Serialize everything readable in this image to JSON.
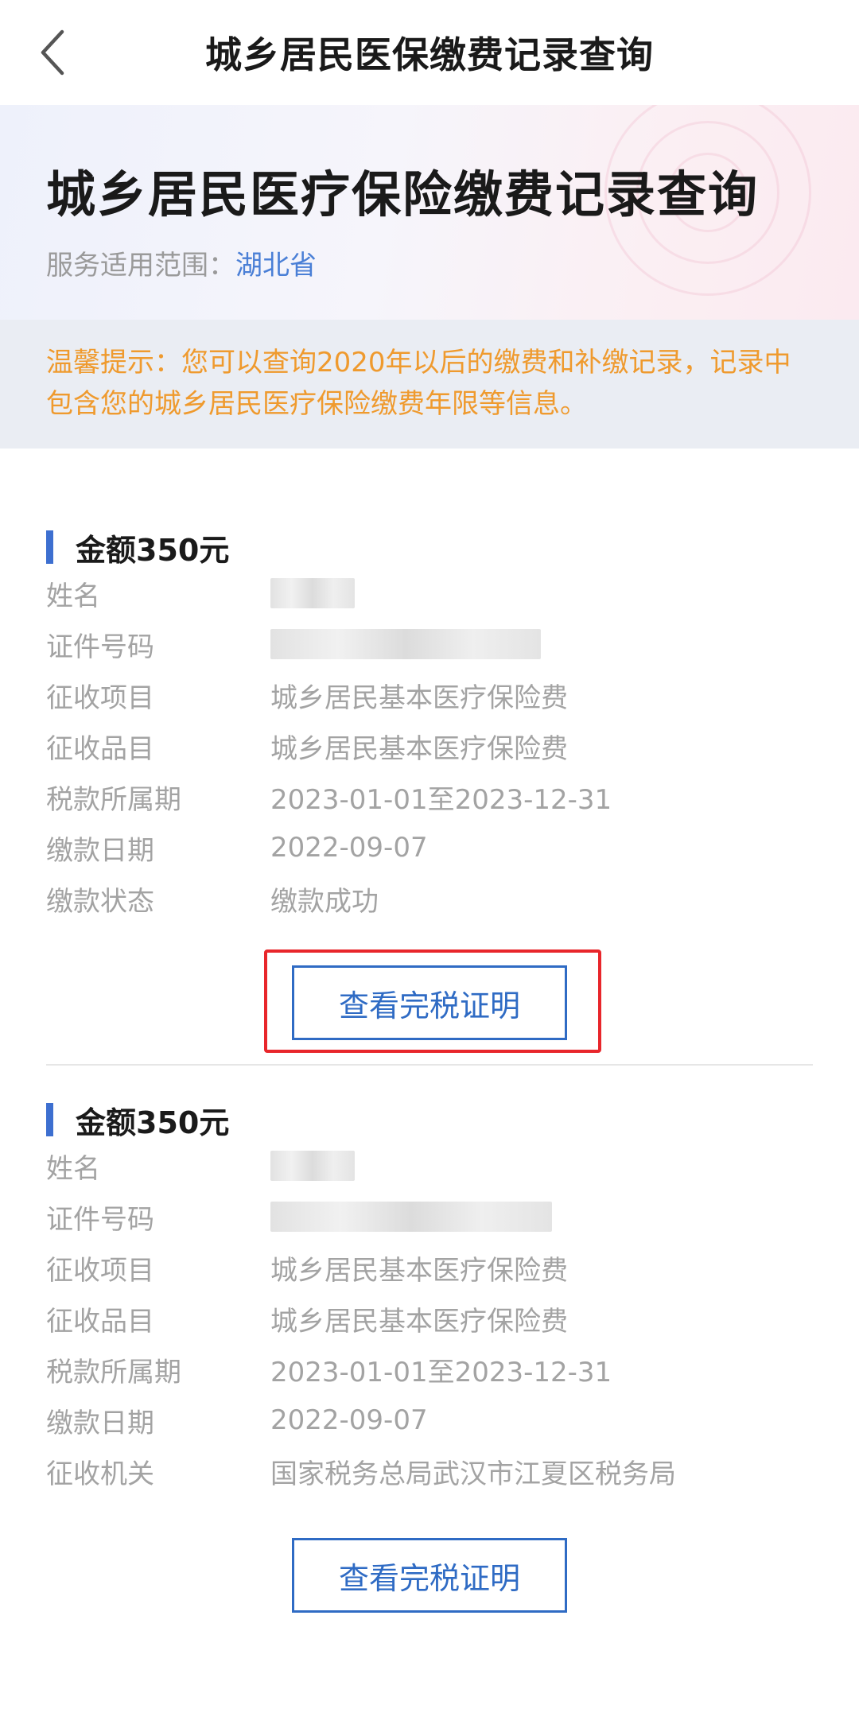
{
  "nav": {
    "title": "城乡居民医保缴费记录查询"
  },
  "hero": {
    "title": "城乡居民医疗保险缴费记录查询",
    "scope_label": "服务适用范围：",
    "scope_value": "湖北省"
  },
  "notice": {
    "text": "温馨提示：您可以查询2020年以后的缴费和补缴记录，记录中包含您的城乡居民医疗保险缴费年限等信息。"
  },
  "records": [
    {
      "title": "金额350元",
      "fields": [
        {
          "label": "姓名",
          "value": ""
        },
        {
          "label": "证件号码",
          "value": ""
        },
        {
          "label": "征收项目",
          "value": "城乡居民基本医疗保险费"
        },
        {
          "label": "征收品目",
          "value": "城乡居民基本医疗保险费"
        },
        {
          "label": "税款所属期",
          "value": "2023-01-01至2023-12-31"
        },
        {
          "label": "缴款日期",
          "value": "2022-09-07"
        },
        {
          "label": "缴款状态",
          "value": "缴款成功"
        }
      ],
      "button_label": "查看完税证明"
    },
    {
      "title": "金额350元",
      "fields": [
        {
          "label": "姓名",
          "value": ""
        },
        {
          "label": "证件号码",
          "value": ""
        },
        {
          "label": "征收项目",
          "value": "城乡居民基本医疗保险费"
        },
        {
          "label": "征收品目",
          "value": "城乡居民基本医疗保险费"
        },
        {
          "label": "税款所属期",
          "value": "2023-01-01至2023-12-31"
        },
        {
          "label": "缴款日期",
          "value": "2022-09-07"
        },
        {
          "label": "征收机关",
          "value": "国家税务总局武汉市江夏区税务局"
        }
      ],
      "button_label": "查看完税证明"
    }
  ],
  "colors": {
    "accent": "#2f6bc4",
    "notice": "#ef9a2e",
    "highlight": "#e8262b"
  }
}
